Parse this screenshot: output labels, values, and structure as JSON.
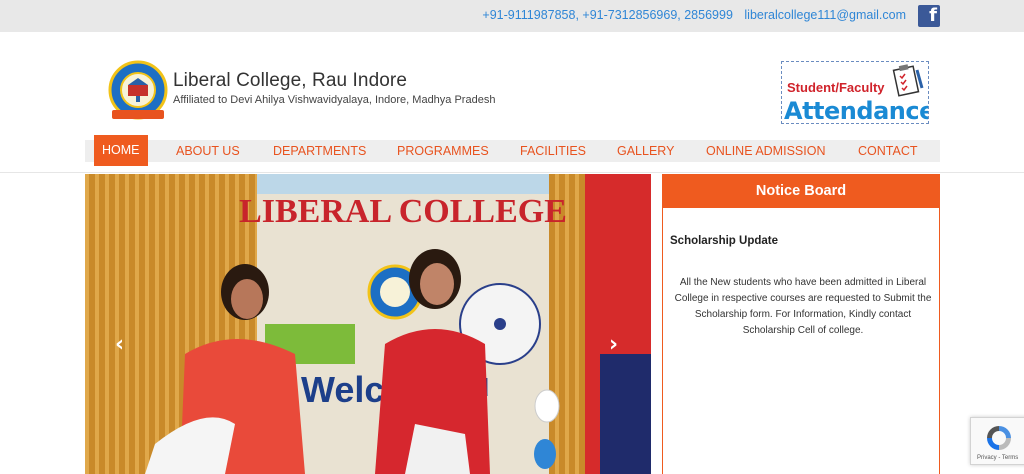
{
  "topbar": {
    "phones": "+91-9111987858, +91-7312856969, 2856999",
    "email": "liberalcollege111@gmail.com",
    "facebook_icon": "facebook-icon"
  },
  "header": {
    "college_name": "Liberal College, Rau Indore",
    "affiliation": "Affiliated to Devi Ahilya Vishwavidyalaya, Indore, Madhya Pradesh",
    "logo_text_top": "LIBERAL COLLEGE",
    "logo_text_bottom": "INDORE",
    "logo_motto": "BELIEVE IN MERIT",
    "attendance_line1": "Student/Faculty",
    "attendance_line2": "Attendance"
  },
  "nav": {
    "items": [
      {
        "label": "HOME"
      },
      {
        "label": "ABOUT US"
      },
      {
        "label": "DEPARTMENTS"
      },
      {
        "label": "PROGRAMMES"
      },
      {
        "label": "FACILITIES"
      },
      {
        "label": "GALLERY"
      },
      {
        "label": "ONLINE ADMISSION"
      },
      {
        "label": "CONTACT"
      }
    ],
    "active_index": 0
  },
  "slider": {
    "banner_title": "LIBERAL COLLEGE",
    "banner_welcome": "Welco",
    "banner_partial": "u",
    "prev_label": "‹",
    "next_label": "›"
  },
  "notice_board": {
    "heading": "Notice Board",
    "title": "Scholarship Update",
    "body": "All the New students who have been admitted in Liberal College in respective courses are requested to  Submit the Scholarship form. For Information, Kindly contact Scholarship Cell of college."
  },
  "recaptcha": {
    "links": "Privacy - Terms"
  },
  "colors": {
    "accent": "#ef5b1f",
    "link_blue": "#2f86d6",
    "topbar_bg": "#e8e8e8",
    "facebook": "#3b5998"
  }
}
